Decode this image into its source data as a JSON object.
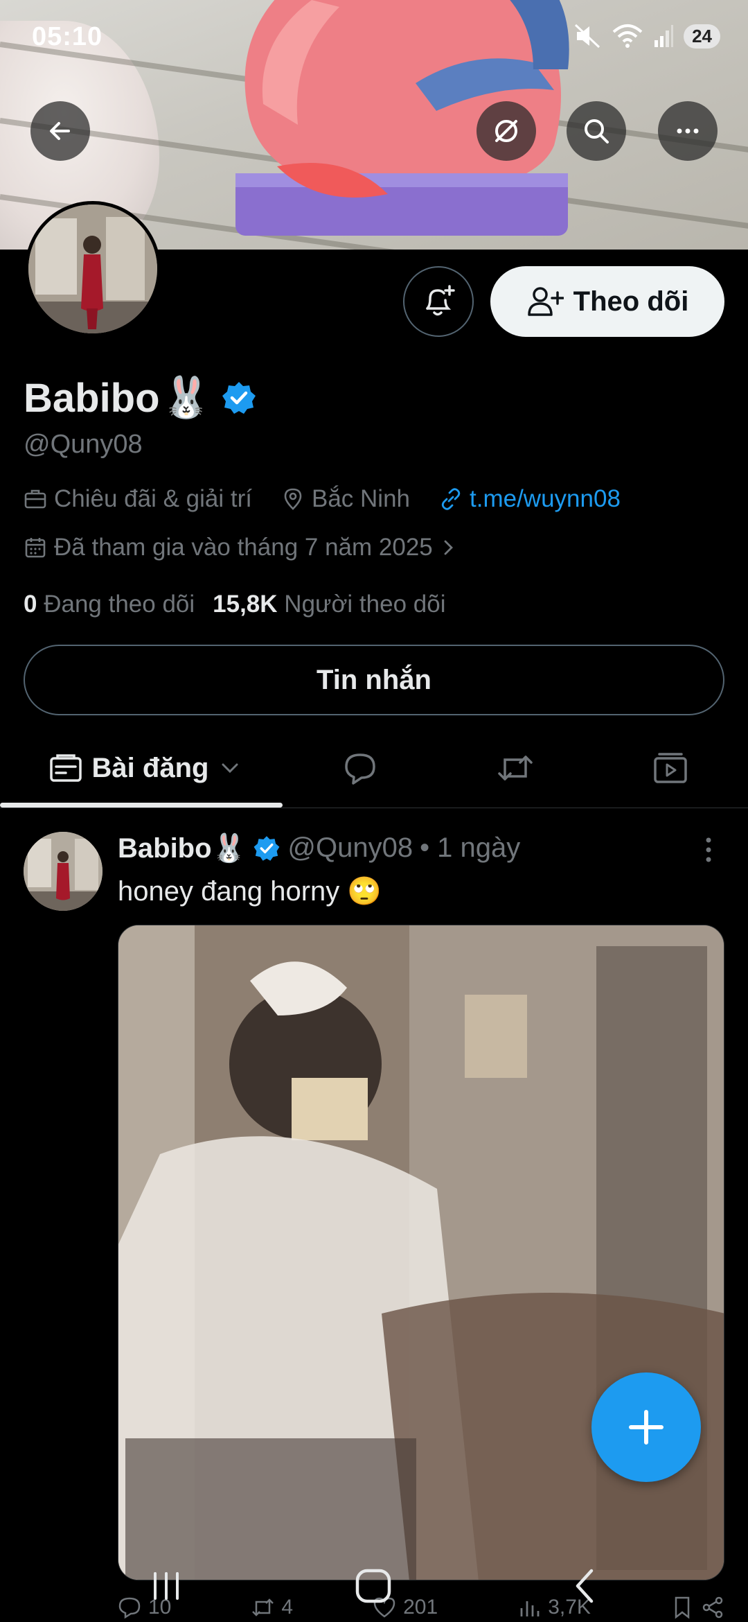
{
  "status_bar": {
    "time": "05:10",
    "battery": "24"
  },
  "profile": {
    "display_name": "Babibo",
    "name_emoji": "🐰",
    "handle": "@Quny08",
    "category": "Chiêu đãi & giải trí",
    "location": "Bắc Ninh",
    "link": "t.me/wuynn08",
    "joined": "Đã tham gia vào tháng 7 năm 2025",
    "following_count": "0",
    "following_label": "Đang theo dõi",
    "followers_count": "15,8K",
    "followers_label": "Người theo dõi"
  },
  "buttons": {
    "follow": "Theo dõi",
    "message": "Tin nhắn"
  },
  "tabs": {
    "active_label": "Bài đăng"
  },
  "post": {
    "name": "Babibo",
    "name_emoji": "🐰",
    "handle": "@Quny08",
    "time": "• 1 ngày",
    "text": "honey đang horny",
    "text_emoji": "🙄",
    "replies": "10",
    "reposts": "4",
    "likes": "201",
    "views": "3,7K"
  },
  "colors": {
    "accent": "#1d9bf0",
    "background": "#000000",
    "muted": "#71767b"
  },
  "icons": [
    "back-arrow-icon",
    "no-sync-icon",
    "search-icon",
    "more-icon",
    "bell-plus-icon",
    "add-user-icon",
    "verified-badge-icon",
    "briefcase-icon",
    "location-pin-icon",
    "link-icon",
    "calendar-icon",
    "chevron-right-icon",
    "posts-tab-icon",
    "replies-tab-icon",
    "reposts-tab-icon",
    "media-tab-icon",
    "compose-plus-icon"
  ]
}
